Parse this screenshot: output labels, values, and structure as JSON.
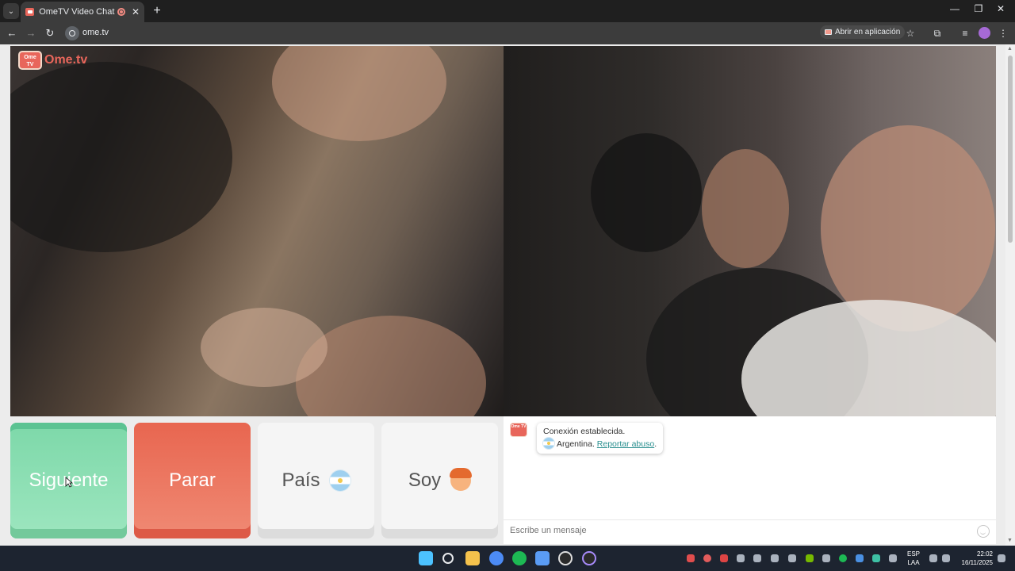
{
  "browser": {
    "tab_title": "OmeTV Video Chat — Ome",
    "url": "ome.tv",
    "open_app_label": "Abrir en aplicación"
  },
  "site": {
    "logo_badge": "Ome TV",
    "logo_text": "Ome.tv"
  },
  "controls": {
    "next_label": "Siguiente",
    "stop_label": "Parar",
    "country_label": "País",
    "gender_label": "Soy"
  },
  "chat": {
    "badge": "Ome TV",
    "status": "Conexión establecida.",
    "country": "Argentina.",
    "report_link": "Reportar abuso",
    "period": ".",
    "input_placeholder": "Escribe un mensaje"
  },
  "taskbar": {
    "lang_top": "ESP",
    "lang_bottom": "LAA",
    "time": "22:02",
    "date": "16/11/2025"
  },
  "colors": {
    "next": "#7dd8a9",
    "stop": "#e86650",
    "brand": "#e8665b",
    "link": "#2a8f8f"
  }
}
